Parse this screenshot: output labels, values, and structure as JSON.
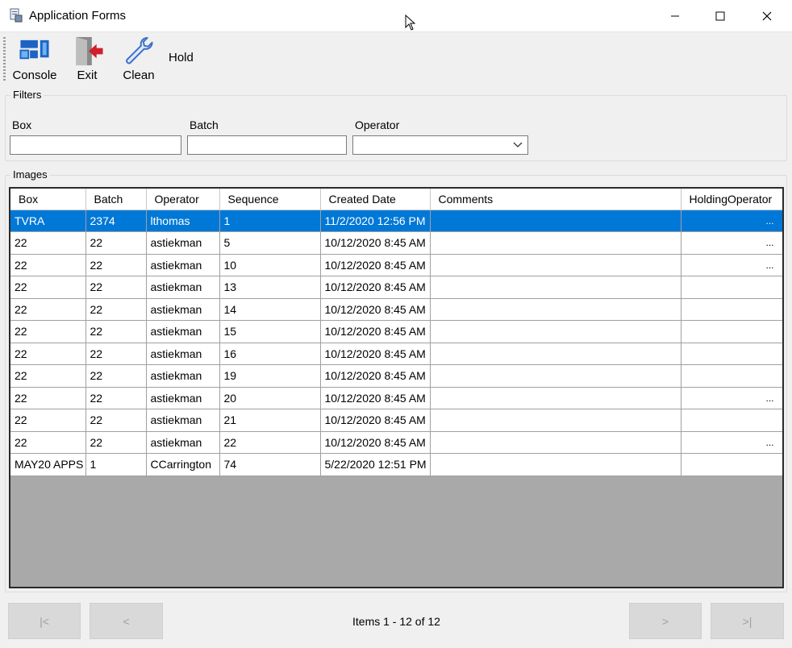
{
  "window": {
    "title": "Application Forms",
    "minimize_glyph": "—",
    "maximize_glyph": "☐",
    "close_glyph": "✕"
  },
  "toolbar": {
    "console_label": "Console",
    "exit_label": "Exit",
    "clean_label": "Clean",
    "hold_label": "Hold",
    "icons": {
      "console": "console-icon",
      "exit": "exit-door-icon",
      "clean": "wrench-icon"
    }
  },
  "filters": {
    "legend": "Filters",
    "box_label": "Box",
    "batch_label": "Batch",
    "operator_label": "Operator",
    "box_value": "",
    "batch_value": "",
    "operator_value": ""
  },
  "images": {
    "legend": "Images",
    "columns": [
      "Box",
      "Batch",
      "Operator",
      "Sequence",
      "Created Date",
      "Comments",
      "HoldingOperator"
    ],
    "rows": [
      {
        "box": "TVRA",
        "batch": "2374",
        "operator": "lthomas",
        "sequence": "1",
        "created": "11/2/2020 12:56 PM",
        "comments": "",
        "holding": "...",
        "selected": true
      },
      {
        "box": "22",
        "batch": "22",
        "operator": "astiekman",
        "sequence": "5",
        "created": "10/12/2020 8:45 AM",
        "comments": "",
        "holding": "..."
      },
      {
        "box": "22",
        "batch": "22",
        "operator": "astiekman",
        "sequence": "10",
        "created": "10/12/2020 8:45 AM",
        "comments": "",
        "holding": "..."
      },
      {
        "box": "22",
        "batch": "22",
        "operator": "astiekman",
        "sequence": "13",
        "created": "10/12/2020 8:45 AM",
        "comments": "",
        "holding": ""
      },
      {
        "box": "22",
        "batch": "22",
        "operator": "astiekman",
        "sequence": "14",
        "created": "10/12/2020 8:45 AM",
        "comments": "",
        "holding": ""
      },
      {
        "box": "22",
        "batch": "22",
        "operator": "astiekman",
        "sequence": "15",
        "created": "10/12/2020 8:45 AM",
        "comments": "",
        "holding": ""
      },
      {
        "box": "22",
        "batch": "22",
        "operator": "astiekman",
        "sequence": "16",
        "created": "10/12/2020 8:45 AM",
        "comments": "",
        "holding": ""
      },
      {
        "box": "22",
        "batch": "22",
        "operator": "astiekman",
        "sequence": "19",
        "created": "10/12/2020 8:45 AM",
        "comments": "",
        "holding": ""
      },
      {
        "box": "22",
        "batch": "22",
        "operator": "astiekman",
        "sequence": "20",
        "created": "10/12/2020 8:45 AM",
        "comments": "",
        "holding": "..."
      },
      {
        "box": "22",
        "batch": "22",
        "operator": "astiekman",
        "sequence": "21",
        "created": "10/12/2020 8:45 AM",
        "comments": "",
        "holding": ""
      },
      {
        "box": "22",
        "batch": "22",
        "operator": "astiekman",
        "sequence": "22",
        "created": "10/12/2020 8:45 AM",
        "comments": "",
        "holding": "..."
      },
      {
        "box": "MAY20 APPS",
        "batch": "1",
        "operator": "CCarrington",
        "sequence": "74",
        "created": "5/22/2020 12:51 PM",
        "comments": "",
        "holding": ""
      }
    ]
  },
  "pager": {
    "first_label": "|<",
    "prev_label": "<",
    "next_label": ">",
    "last_label": ">|",
    "info": "Items 1 - 12 of 12"
  },
  "colors": {
    "selection": "#0078d7",
    "grid_empty": "#a9a9a9",
    "exit_arrow": "#d0202a",
    "console_blue": "#1e63c4",
    "wrench_blue": "#3b6fc7"
  }
}
